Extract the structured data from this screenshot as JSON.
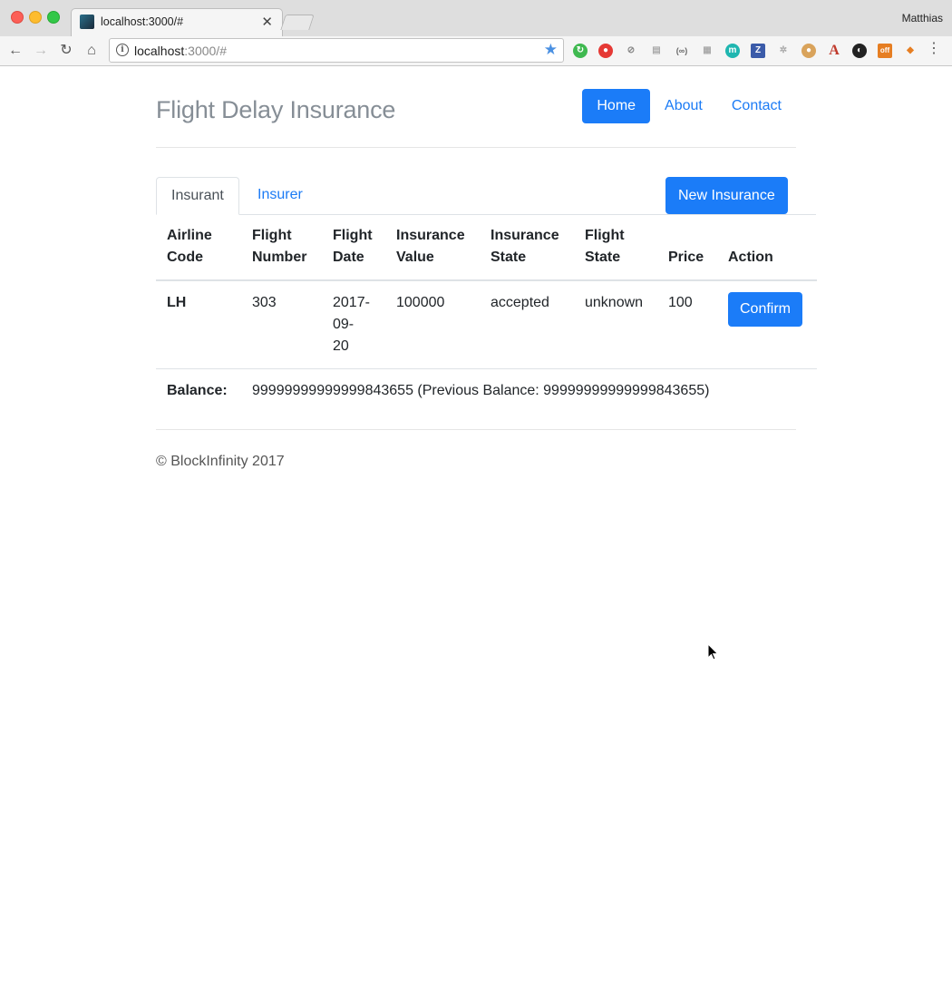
{
  "browser": {
    "tab_title": "localhost:3000/#",
    "profile": "Matthias",
    "url_host": "localhost",
    "url_rest": ":3000/#"
  },
  "page": {
    "brand": "Flight Delay Insurance",
    "nav": [
      {
        "label": "Home",
        "active": true
      },
      {
        "label": "About",
        "active": false
      },
      {
        "label": "Contact",
        "active": false
      }
    ],
    "tabs": [
      {
        "label": "Insurant",
        "active": true
      },
      {
        "label": "Insurer",
        "active": false
      }
    ],
    "new_insurance_label": "New Insurance",
    "table": {
      "headers": [
        "Airline Code",
        "Flight Number",
        "Flight Date",
        "Insurance Value",
        "Insurance State",
        "Flight State",
        "Price",
        "Action"
      ],
      "rows": [
        {
          "airline_code": "LH",
          "flight_number": "303",
          "flight_date": "2017-09-20",
          "insurance_value": "100000",
          "insurance_state": "accepted",
          "flight_state": "unknown",
          "price": "100",
          "action_label": "Confirm"
        }
      ],
      "balance_label": "Balance:",
      "balance_text": "99999999999999843655 (Previous Balance: 99999999999999843655)"
    },
    "footer": "© BlockInfinity 2017"
  },
  "colors": {
    "primary": "#1b7cf8",
    "brand_gray": "#868e96",
    "border": "#dee2e6"
  }
}
